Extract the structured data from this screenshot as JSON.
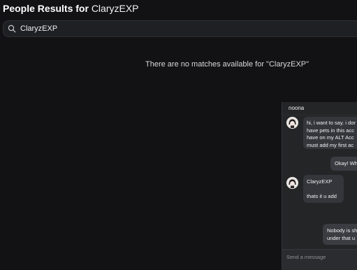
{
  "header": {
    "prefix": "People Results for ",
    "query": "ClaryzEXP"
  },
  "search": {
    "value": "ClaryzEXP",
    "icon": "search-icon"
  },
  "results": {
    "empty_message": "There are no matches available for \"ClaryzEXP\""
  },
  "chat": {
    "title": "noona",
    "messages": [
      {
        "from": "received",
        "lines": [
          "hi, i want to say. i dor",
          "have pets in this acc",
          "have on my ALT Acc",
          "must add my first ac"
        ]
      },
      {
        "from": "sent",
        "lines": [
          "Okay! Why"
        ]
      },
      {
        "from": "received",
        "lines": [
          "ClaryzEXP",
          "",
          "thats it u add"
        ]
      },
      {
        "from": "sent",
        "lines": [
          "Nobody is sh",
          "under that u"
        ]
      }
    ],
    "input_placeholder": "Send a message"
  },
  "colors": {
    "background": "#121214",
    "chat_background": "#232527",
    "bubble": "#34363b"
  }
}
